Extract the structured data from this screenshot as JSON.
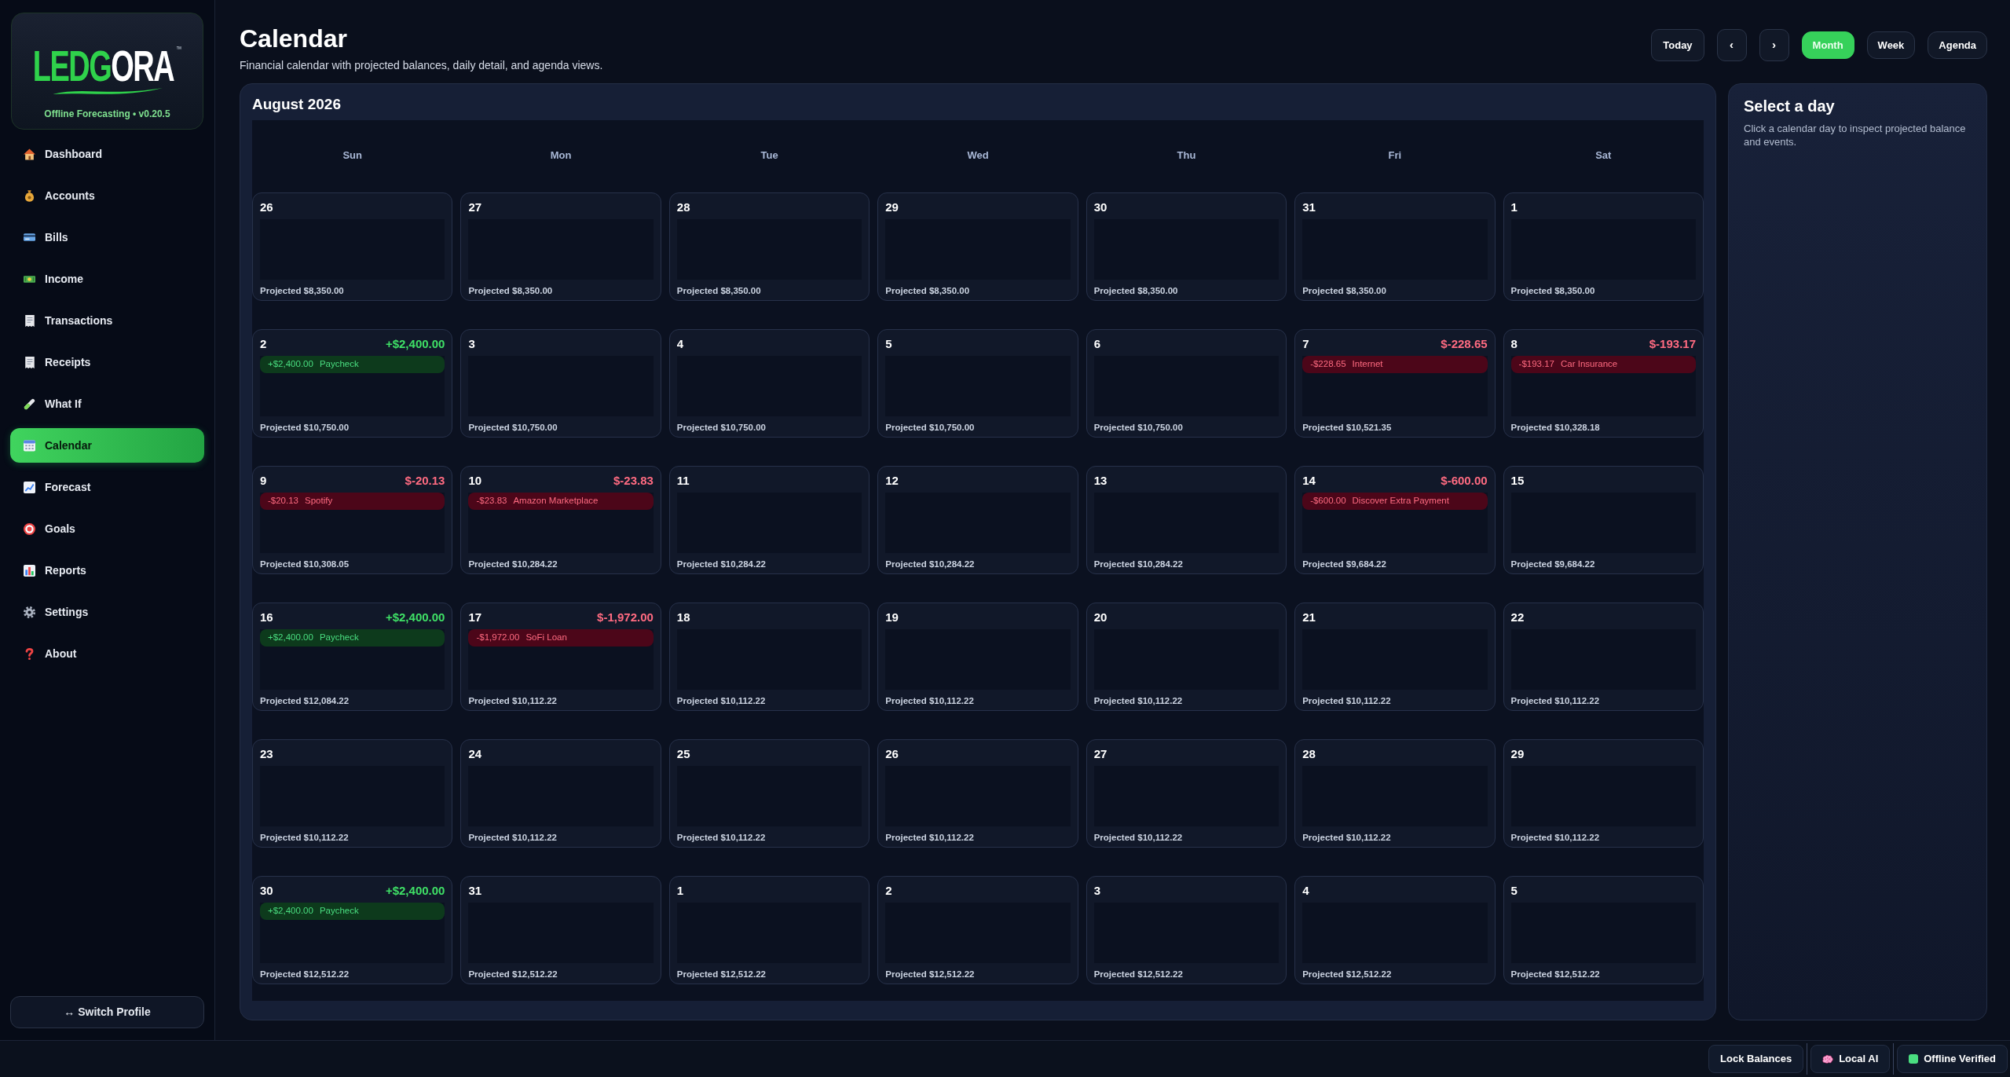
{
  "sidebar": {
    "logo": {
      "lead": "LEDG",
      "tail": "ORA",
      "trademark": "™",
      "tagline": "Offline Forecasting • v0.20.5"
    },
    "nav": [
      {
        "label": "Dashboard",
        "selected": false
      },
      {
        "label": "Accounts",
        "selected": false
      },
      {
        "label": "Bills",
        "selected": false
      },
      {
        "label": "Income",
        "selected": false
      },
      {
        "label": "Transactions",
        "selected": false
      },
      {
        "label": "Receipts",
        "selected": false
      },
      {
        "label": "What If",
        "selected": false
      },
      {
        "label": "Calendar",
        "selected": true
      },
      {
        "label": "Forecast",
        "selected": false
      },
      {
        "label": "Goals",
        "selected": false
      },
      {
        "label": "Reports",
        "selected": false
      },
      {
        "label": "Settings",
        "selected": false
      },
      {
        "label": "About",
        "selected": false
      }
    ],
    "switch_profile": "↔ Switch Profile"
  },
  "header": {
    "title": "Calendar",
    "subtitle": "Financial calendar with projected balances, daily detail, and agenda views.",
    "today": "Today",
    "prev": "‹",
    "next": "›",
    "views": [
      {
        "label": "Month",
        "selected": true
      },
      {
        "label": "Week",
        "selected": false
      },
      {
        "label": "Agenda",
        "selected": false
      }
    ]
  },
  "calendar": {
    "title": "August 2026",
    "weekdays": [
      "Sun",
      "Mon",
      "Tue",
      "Wed",
      "Thu",
      "Fri",
      "Sat"
    ],
    "weeks": [
      [
        {
          "day": "26",
          "projected": "Projected $8,350.00"
        },
        {
          "day": "27",
          "projected": "Projected $8,350.00"
        },
        {
          "day": "28",
          "projected": "Projected $8,350.00"
        },
        {
          "day": "29",
          "projected": "Projected $8,350.00"
        },
        {
          "day": "30",
          "projected": "Projected $8,350.00"
        },
        {
          "day": "31",
          "projected": "Projected $8,350.00"
        },
        {
          "day": "1",
          "projected": "Projected $8,350.00"
        }
      ],
      [
        {
          "day": "2",
          "total": {
            "text": "+$2,400.00",
            "kind": "income"
          },
          "projected": "Projected $10,750.00",
          "events": [
            {
              "amount": "+$2,400.00",
              "name": "Paycheck",
              "kind": "income"
            }
          ]
        },
        {
          "day": "3",
          "projected": "Projected $10,750.00"
        },
        {
          "day": "4",
          "projected": "Projected $10,750.00"
        },
        {
          "day": "5",
          "projected": "Projected $10,750.00"
        },
        {
          "day": "6",
          "projected": "Projected $10,750.00"
        },
        {
          "day": "7",
          "total": {
            "text": "$-228.65",
            "kind": "expense"
          },
          "projected": "Projected $10,521.35",
          "events": [
            {
              "amount": "-$228.65",
              "name": "Internet",
              "kind": "expense"
            }
          ]
        },
        {
          "day": "8",
          "total": {
            "text": "$-193.17",
            "kind": "expense"
          },
          "projected": "Projected $10,328.18",
          "events": [
            {
              "amount": "-$193.17",
              "name": "Car Insurance",
              "kind": "expense"
            }
          ]
        }
      ],
      [
        {
          "day": "9",
          "total": {
            "text": "$-20.13",
            "kind": "expense"
          },
          "projected": "Projected $10,308.05",
          "events": [
            {
              "amount": "-$20.13",
              "name": "Spotify",
              "kind": "expense"
            }
          ]
        },
        {
          "day": "10",
          "total": {
            "text": "$-23.83",
            "kind": "expense"
          },
          "projected": "Projected $10,284.22",
          "events": [
            {
              "amount": "-$23.83",
              "name": "Amazon Marketplace",
              "kind": "expense"
            }
          ]
        },
        {
          "day": "11",
          "projected": "Projected $10,284.22"
        },
        {
          "day": "12",
          "projected": "Projected $10,284.22"
        },
        {
          "day": "13",
          "projected": "Projected $10,284.22"
        },
        {
          "day": "14",
          "total": {
            "text": "$-600.00",
            "kind": "expense"
          },
          "projected": "Projected $9,684.22",
          "events": [
            {
              "amount": "-$600.00",
              "name": "Discover Extra Payment",
              "kind": "expense"
            }
          ]
        },
        {
          "day": "15",
          "projected": "Projected $9,684.22"
        }
      ],
      [
        {
          "day": "16",
          "total": {
            "text": "+$2,400.00",
            "kind": "income"
          },
          "projected": "Projected $12,084.22",
          "events": [
            {
              "amount": "+$2,400.00",
              "name": "Paycheck",
              "kind": "income"
            }
          ]
        },
        {
          "day": "17",
          "total": {
            "text": "$-1,972.00",
            "kind": "expense"
          },
          "projected": "Projected $10,112.22",
          "events": [
            {
              "amount": "-$1,972.00",
              "name": "SoFi Loan",
              "kind": "expense"
            }
          ]
        },
        {
          "day": "18",
          "projected": "Projected $10,112.22"
        },
        {
          "day": "19",
          "projected": "Projected $10,112.22"
        },
        {
          "day": "20",
          "projected": "Projected $10,112.22"
        },
        {
          "day": "21",
          "projected": "Projected $10,112.22"
        },
        {
          "day": "22",
          "projected": "Projected $10,112.22"
        }
      ],
      [
        {
          "day": "23",
          "projected": "Projected $10,112.22"
        },
        {
          "day": "24",
          "projected": "Projected $10,112.22"
        },
        {
          "day": "25",
          "projected": "Projected $10,112.22"
        },
        {
          "day": "26",
          "projected": "Projected $10,112.22"
        },
        {
          "day": "27",
          "projected": "Projected $10,112.22"
        },
        {
          "day": "28",
          "projected": "Projected $10,112.22"
        },
        {
          "day": "29",
          "projected": "Projected $10,112.22"
        }
      ],
      [
        {
          "day": "30",
          "total": {
            "text": "+$2,400.00",
            "kind": "income"
          },
          "projected": "Projected $12,512.22",
          "events": [
            {
              "amount": "+$2,400.00",
              "name": "Paycheck",
              "kind": "income"
            }
          ]
        },
        {
          "day": "31",
          "projected": "Projected $12,512.22"
        },
        {
          "day": "1",
          "projected": "Projected $12,512.22"
        },
        {
          "day": "2",
          "projected": "Projected $12,512.22"
        },
        {
          "day": "3",
          "projected": "Projected $12,512.22"
        },
        {
          "day": "4",
          "projected": "Projected $12,512.22"
        },
        {
          "day": "5",
          "projected": "Projected $12,512.22"
        }
      ]
    ]
  },
  "detail": {
    "title": "Select a day",
    "hint": "Click a calendar day to inspect projected balance and events."
  },
  "status_bar": [
    {
      "label": "Lock Balances",
      "kind": "plain"
    },
    {
      "label": "Local AI",
      "kind": "ai"
    },
    {
      "label": "Offline Verified",
      "kind": "verified"
    }
  ]
}
